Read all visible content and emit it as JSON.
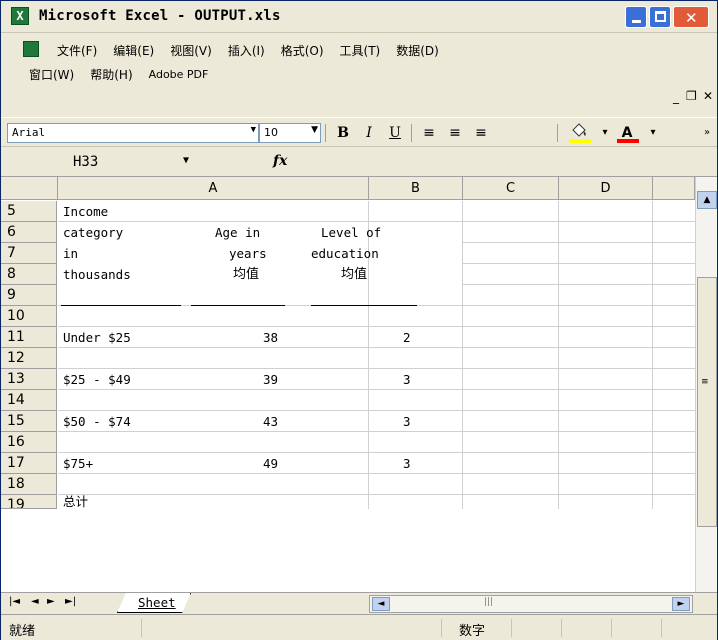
{
  "window": {
    "title": "Microsoft Excel - OUTPUT.xls",
    "app_icon": "excel-icon"
  },
  "menu": {
    "row1": [
      "文件(F)",
      "编辑(E)",
      "视图(V)",
      "插入(I)",
      "格式(O)",
      "工具(T)",
      "数据(D)"
    ],
    "row2": [
      "窗口(W)",
      "帮助(H)",
      "Adobe PDF"
    ]
  },
  "toolbar": {
    "font": "Arial",
    "size": "10",
    "bold": "B",
    "italic": "I",
    "underline": "U",
    "align_left": "≡",
    "align_center": "≡",
    "align_right": "≡",
    "fill_color": "#ffff00",
    "font_color": "#ff0000"
  },
  "formula": {
    "name_box": "H33",
    "fx": "fx",
    "content": ""
  },
  "grid": {
    "columns": [
      "A",
      "B",
      "C",
      "D"
    ],
    "rows": [
      "5",
      "6",
      "7",
      "8",
      "9",
      "10",
      "11",
      "12",
      "13",
      "14",
      "15",
      "16",
      "17",
      "18",
      "19"
    ],
    "cells": {
      "r5": {
        "a1": "Income",
        "a2": "",
        "b": ""
      },
      "r6": {
        "a1": "category",
        "a2": "Age in",
        "b": "Level of"
      },
      "r7": {
        "a1": "in",
        "a2": "years",
        "b": "education"
      },
      "r8": {
        "a1": "thousands",
        "a2": "均值",
        "b": "均值"
      },
      "r11": {
        "a1": "Under $25",
        "a2": "38",
        "b": "2"
      },
      "r13": {
        "a1": "$25 - $49",
        "a2": "39",
        "b": "3"
      },
      "r15": {
        "a1": "$50 - $74",
        "a2": "43",
        "b": "3"
      },
      "r17": {
        "a1": "$75+",
        "a2": "49",
        "b": "3"
      },
      "r19": {
        "a1": "总计"
      }
    }
  },
  "sheets": {
    "active": "Sheet"
  },
  "status": {
    "ready": "就绪",
    "num": "数字"
  }
}
